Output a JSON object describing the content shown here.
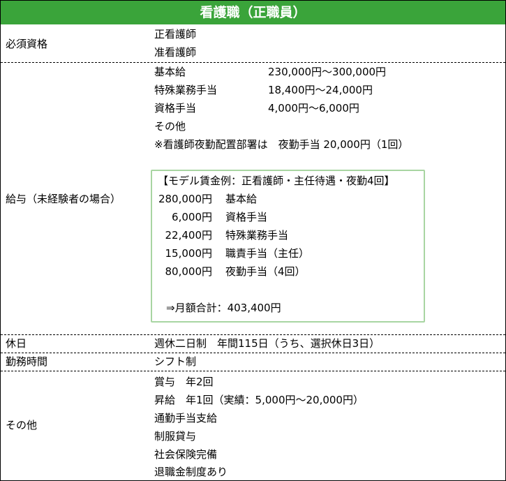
{
  "title": "看護職（正職員）",
  "qualifications": {
    "label": "必須資格",
    "items": [
      "正看護師",
      "准看護師"
    ]
  },
  "salary": {
    "label": "給与（未経験者の場合）",
    "items": [
      {
        "name": "基本給",
        "value": "230,000円〜300,000円"
      },
      {
        "name": "特殊業務手当",
        "value": "18,400円〜24,000円"
      },
      {
        "name": "資格手当",
        "value": "4,000円〜6,000円"
      }
    ],
    "other": "その他",
    "note": "※看護師夜勤配置部署は　夜勤手当 20,000円（1回）",
    "model": {
      "heading": "【モデル賃金例：正看護師・主任待遇・夜勤4回】",
      "lines": [
        {
          "amount": "280,000円",
          "label": "基本給"
        },
        {
          "amount": "6,000円",
          "label": "資格手当"
        },
        {
          "amount": "22,400円",
          "label": "特殊業務手当"
        },
        {
          "amount": "15,000円",
          "label": "職責手当（主任）"
        },
        {
          "amount": "80,000円",
          "label": "夜勤手当（4回）"
        }
      ],
      "total": "⇒月額合計：403,400円"
    }
  },
  "holidays": {
    "label": "休日",
    "value": "週休二日制　年間115日（うち、選択休日3日）"
  },
  "work_hours": {
    "label": "勤務時間",
    "value": "シフト制"
  },
  "others": {
    "label": "その他",
    "items": [
      "賞与　年2回",
      "昇給　年1回（実績：5,000円〜20,000円）",
      "通勤手当支給",
      "制服貸与",
      "社会保険完備",
      "退職金制度あり"
    ]
  },
  "colors": {
    "title_bar": "#3aa43a",
    "model_box_border": "#a8d5a2"
  }
}
